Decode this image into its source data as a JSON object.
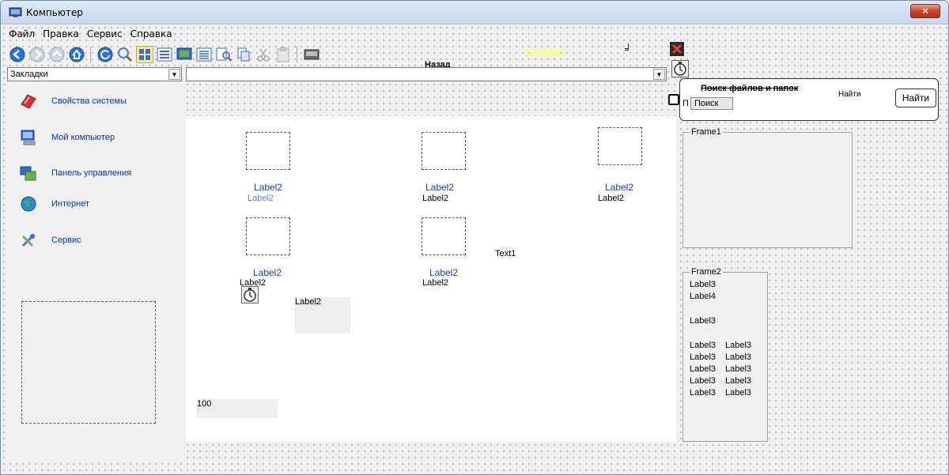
{
  "window": {
    "title": "Компьютер",
    "close_label": "✕"
  },
  "menu": [
    "Файл",
    "Правка",
    "Сервис",
    "Справка"
  ],
  "toolbar": {
    "back_label": "Назад",
    "header_label": "header",
    "buttons": [
      "back-icon",
      "forward-icon",
      "up-icon",
      "home-icon",
      "refresh-icon",
      "search-icon",
      "large-icons-view-icon",
      "list-view-icon",
      "thumbnails-view-icon",
      "details-view-icon",
      "find-icon",
      "copy-icon",
      "cut-icon",
      "paste-icon",
      "drive-icon"
    ]
  },
  "bookmarks_combo": {
    "value": "Закладки"
  },
  "address_combo": {
    "value": ""
  },
  "sidebar": {
    "items": [
      {
        "label": "Свойства системы",
        "icon": "system-properties-icon"
      },
      {
        "label": "Мой компьютер",
        "icon": "my-computer-icon"
      },
      {
        "label": "Панель управления",
        "icon": "control-panel-icon"
      },
      {
        "label": "Интернет",
        "icon": "internet-icon"
      },
      {
        "label": "Сервис",
        "icon": "tools-icon"
      }
    ]
  },
  "canvas": {
    "cells": [
      {
        "title": "Label2",
        "sub": "Label2"
      },
      {
        "title": "Label2",
        "sub": "Label2"
      },
      {
        "title": "Label2",
        "sub": "Label2"
      },
      {
        "title": "Label2",
        "sub": "Label2"
      },
      {
        "title": "Label2",
        "sub": "Label2"
      }
    ],
    "text1": "Text1",
    "overlap_label": "Label2",
    "box_label": "Label2",
    "progress_value": "100"
  },
  "search": {
    "title": "Поиск файлов и папок",
    "find_small": "Найти",
    "find_button": "Найти",
    "search_button": "Поиск",
    "n_label": "П"
  },
  "frame1": {
    "title": "Frame1"
  },
  "frame2": {
    "title": "Frame2",
    "labels": [
      "Label3",
      "Label4",
      "Label3"
    ],
    "grid": [
      [
        "Label3",
        "Label3"
      ],
      [
        "Label3",
        "Label3"
      ],
      [
        "Label3",
        "Label3"
      ],
      [
        "Label3",
        "Label3"
      ],
      [
        "Label3",
        "Label3"
      ]
    ]
  },
  "colors": {
    "link": "#1a3ccd",
    "header": "#ffff66",
    "close": "#c7462b"
  }
}
